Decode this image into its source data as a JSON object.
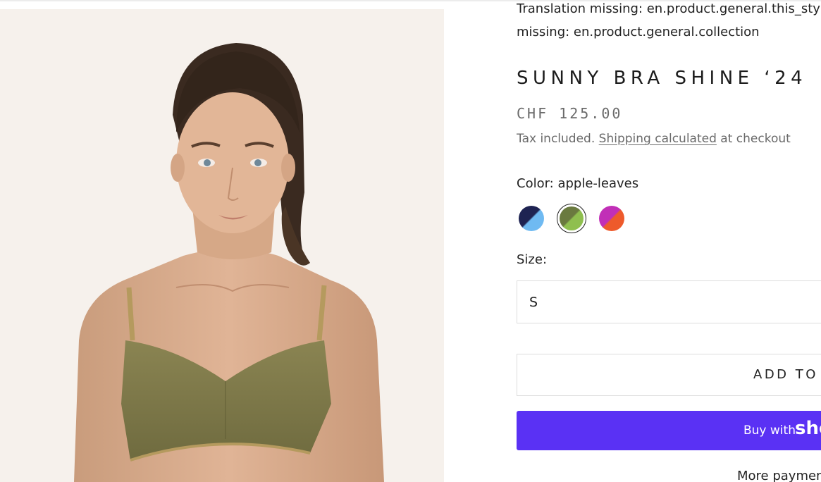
{
  "product": {
    "image_alt": "Model wearing olive bikini bra",
    "notice_line1": "Translation missing: en.product.general.this_style",
    "notice_line2": "missing: en.product.general.collection",
    "title": "SUNNY BRA SHINE ‘24",
    "price": "CHF 125.00",
    "tax_prefix": "Tax included.",
    "shipping_link": "Shipping calculated",
    "tax_suffix": "at checkout"
  },
  "color": {
    "label": "Color: apple-leaves",
    "swatches": [
      {
        "name": "navy-sky",
        "colors": [
          "#1e2352",
          "#6fbaf2"
        ],
        "selected": false
      },
      {
        "name": "apple-leaves",
        "colors": [
          "#6a7a3f",
          "#8fbf4f"
        ],
        "selected": true
      },
      {
        "name": "magenta-orange",
        "colors": [
          "#c12fb7",
          "#ee5a2b"
        ],
        "selected": false
      }
    ]
  },
  "size": {
    "label": "Size:",
    "selected": "S"
  },
  "actions": {
    "add_to_cart": "ADD TO CART",
    "buy_with_text": "Buy with",
    "buy_with_brand": "shop",
    "more_payment": "More payment options"
  },
  "colors": {
    "buy_button_bg": "#5a31f4",
    "image_bg": "#f6f1ec"
  }
}
